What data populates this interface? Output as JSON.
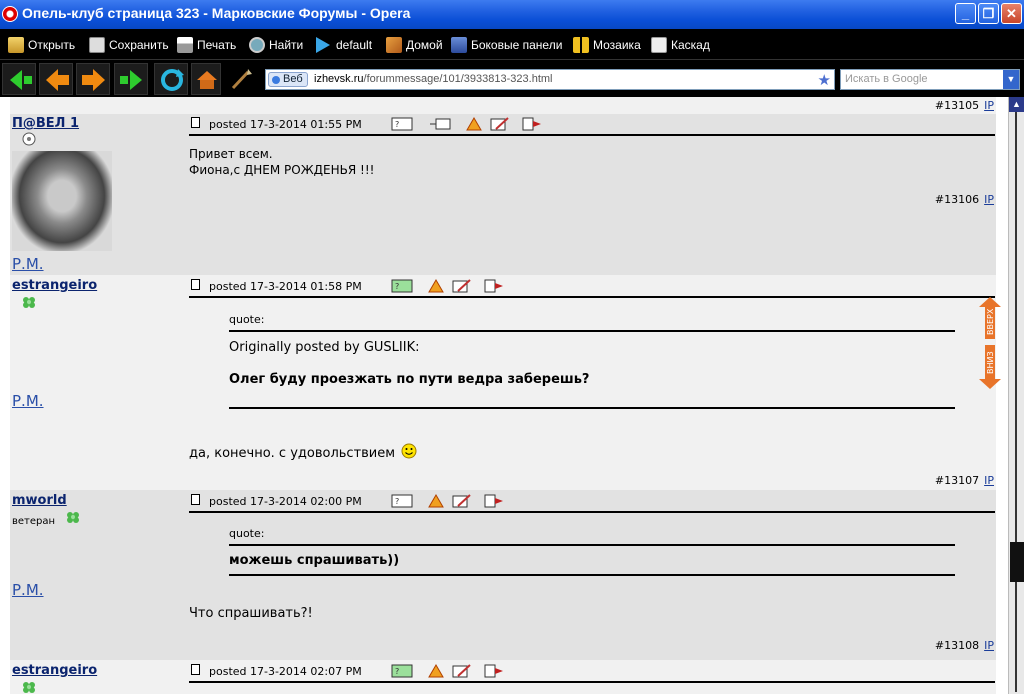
{
  "window": {
    "title": "Опель-клуб страница 323 - Марковские Форумы - Opera",
    "minimize": "_",
    "restore": "❐",
    "close": "✕"
  },
  "menubar": {
    "items": [
      {
        "label": "Открыть",
        "icon": "open-icon"
      },
      {
        "label": "Сохранить",
        "icon": "save-icon"
      },
      {
        "label": "Печать",
        "icon": "print-icon"
      },
      {
        "label": "Найти",
        "icon": "find-icon"
      },
      {
        "label": "default",
        "icon": "play-icon"
      },
      {
        "label": "Домой",
        "icon": "home-icon"
      },
      {
        "label": "Боковые панели",
        "icon": "panels-icon"
      },
      {
        "label": "Мозаика",
        "icon": "tile-icon"
      },
      {
        "label": "Каскад",
        "icon": "cascade-icon"
      }
    ]
  },
  "addressbar": {
    "badge": "Веб",
    "url_domain": "izhevsk.ru",
    "url_path": "/forummessage/101/3933813-323.html",
    "search_placeholder": "Искать в Google"
  },
  "posts": [
    {
      "num_prev": "#13105",
      "author": "П@ВЕЛ 1",
      "rm": "Р.М.",
      "posted": "posted 17-3-2014 01:55 PM",
      "lines": [
        "Привет всем.",
        "Фиона,с ДНЕМ РОЖДЕНЬЯ !!!"
      ],
      "num": "#13106"
    },
    {
      "author": "estrangeiro",
      "rm": "Р.М.",
      "posted": "posted 17-3-2014 01:58 PM",
      "quote_label": "quote:",
      "quote_by": "Originally posted by GUSLIIK:",
      "quote_text": "Олег буду проезжать по пути ведра заберешь?",
      "reply": "да, конечно. с удовольствием",
      "num": "#13107"
    },
    {
      "author": "mworld",
      "rank": "ветеран",
      "rm": "Р.М.",
      "posted": "posted 17-3-2014 02:00 PM",
      "quote_label": "quote:",
      "quote_text": "можешь спрашивать))",
      "reply": "Что спрашивать?!",
      "num": "#13108"
    },
    {
      "author": "estrangeiro",
      "posted": "posted 17-3-2014 02:07 PM"
    }
  ],
  "ip_label": "IP",
  "nav": {
    "up": "ВВЕРХ",
    "down": "ВНИЗ"
  },
  "colors": {
    "accent": "#0b246e",
    "link": "#2a4fa8",
    "post_gray": "#e2e2e2",
    "post_light": "#f1f1f1"
  }
}
